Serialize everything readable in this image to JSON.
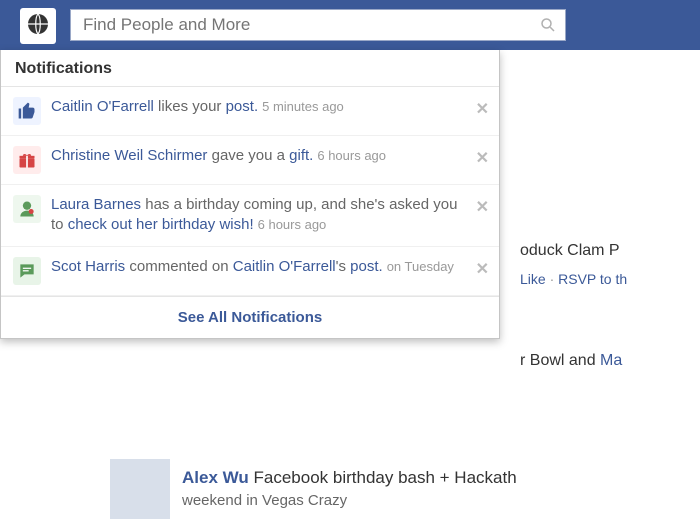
{
  "search": {
    "placeholder": "Find People and More"
  },
  "dropdown": {
    "title": "Notifications",
    "footer": "See All Notifications"
  },
  "notifications": [
    {
      "icon": "like",
      "personA": "Caitlin O'Farrell",
      "middle": " likes your ",
      "object": "post.",
      "time": "5 minutes ago"
    },
    {
      "icon": "gift",
      "personA": "Christine Weil Schirmer",
      "middle": " gave you a ",
      "object": "gift.",
      "time": "6 hours ago"
    },
    {
      "icon": "birthday",
      "personA": "Laura Barnes",
      "middle": " has a birthday coming up, and she's asked you to ",
      "object": "check out her birthday wish!",
      "time": "6 hours ago"
    },
    {
      "icon": "comment",
      "personA": "Scot Harris",
      "middle": " commented on ",
      "personB": "Caitlin O'Farrell",
      "tail": "'s ",
      "object": "post.",
      "time": "on Tuesday"
    }
  ],
  "feed": {
    "event1_title_fragment": "oduck Clam P",
    "event1_actions_like": "Like",
    "event1_actions_sep": " · ",
    "event1_actions_rsvp": "RSVP to th",
    "event2_fragment_a": "r Bowl",
    "event2_fragment_mid": " and ",
    "event2_fragment_b": "Ma",
    "bottom_name": "Alex Wu",
    "bottom_rest": " Facebook birthday bash + Hackath",
    "bottom_sub": "weekend in Vegas  Crazy"
  }
}
